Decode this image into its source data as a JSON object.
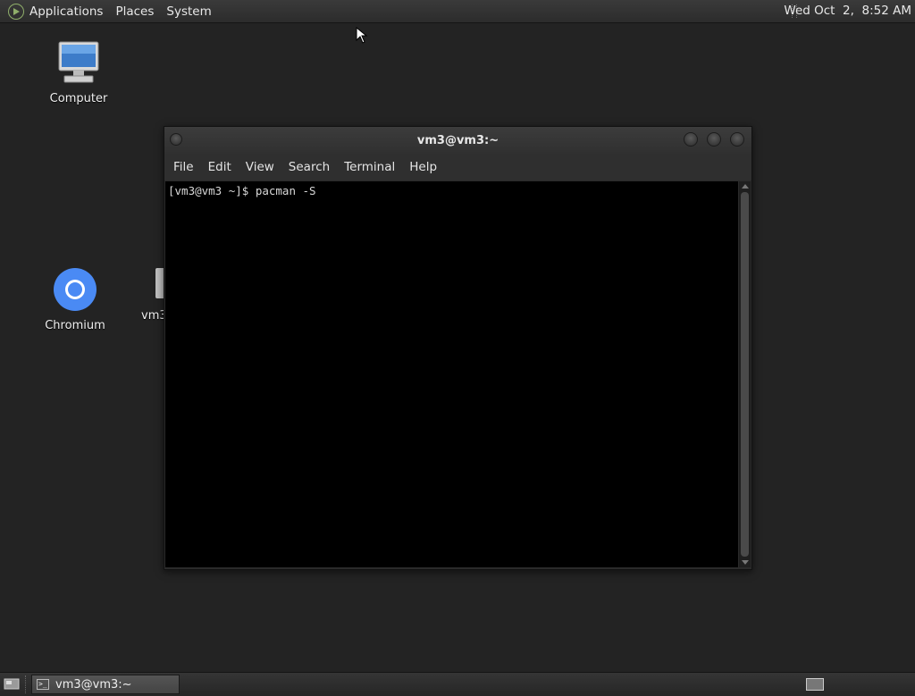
{
  "top_panel": {
    "menus": [
      "Applications",
      "Places",
      "System"
    ],
    "clock": "Wed Oct  2,  8:52 AM"
  },
  "desktop": {
    "icons": {
      "computer": "Computer",
      "chromium": "Chromium",
      "partial": "vm3"
    }
  },
  "terminal": {
    "title": "vm3@vm3:~",
    "menu": [
      "File",
      "Edit",
      "View",
      "Search",
      "Terminal",
      "Help"
    ],
    "lines": [
      "[vm3@vm3 ~]$ pacman -S"
    ]
  },
  "taskbar": {
    "task_label": "vm3@vm3:~"
  },
  "colors": {
    "desktop_bg": "#232323",
    "panel_bg": "#2c2c2c",
    "terminal_bg": "#000000",
    "chromium_blue": "#4a8af4"
  }
}
